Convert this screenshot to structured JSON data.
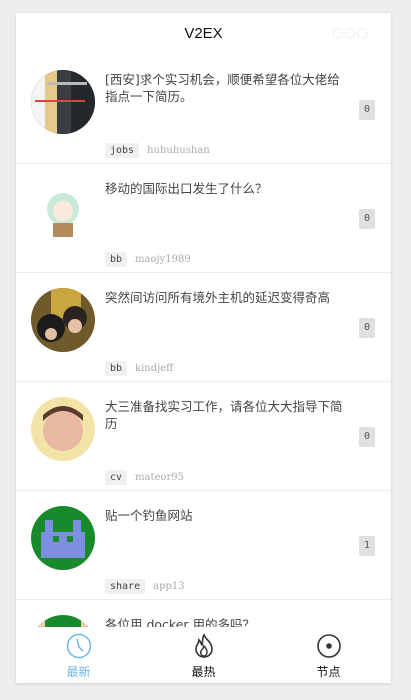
{
  "header": {
    "title": "V2EX",
    "menu_icon": "more-dots-icon"
  },
  "topics": [
    {
      "title": "[西安]求个实习机会，顺便希望各位大佬给指点一下简历。",
      "node": "jobs",
      "user": "huhuhushan",
      "replies": "0",
      "avatar": "code"
    },
    {
      "title": "移动的国际出口发生了什么？",
      "node": "bb",
      "user": "maojy1989",
      "replies": "0",
      "avatar": "anime"
    },
    {
      "title": "突然间访问所有境外主机的延迟变得奇高",
      "node": "bb",
      "user": "kindjeff",
      "replies": "0",
      "avatar": "people"
    },
    {
      "title": "大三准备找实习工作，请各位大大指导下简历",
      "node": "cv",
      "user": "mateor95",
      "replies": "0",
      "avatar": "baby"
    },
    {
      "title": "贴一个钓鱼网站",
      "node": "share",
      "user": "app13",
      "replies": "1",
      "avatar": "pixel"
    },
    {
      "title": "各位用 docker 用的多吗？",
      "node": "",
      "user": "",
      "replies": "",
      "avatar": "pixel2"
    }
  ],
  "tabs": [
    {
      "label": "最新",
      "icon": "clock-icon"
    },
    {
      "label": "最热",
      "icon": "flame-icon"
    },
    {
      "label": "节点",
      "icon": "target-icon"
    }
  ],
  "colors": {
    "accent": "#6fb8ee"
  }
}
